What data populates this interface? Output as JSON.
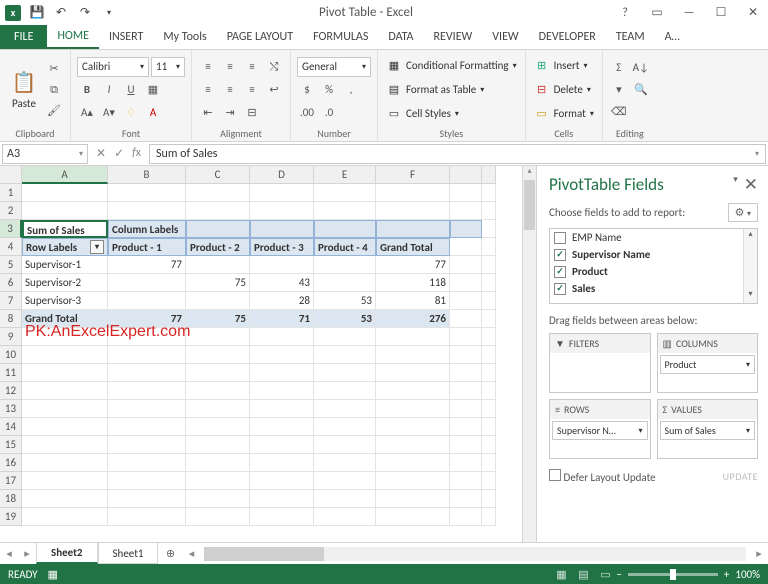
{
  "titlebar": {
    "title": "Pivot Table - Excel",
    "excel_icon_letter": "x"
  },
  "tabs": {
    "file": "FILE",
    "list": [
      "HOME",
      "INSERT",
      "My Tools",
      "PAGE LAYOUT",
      "FORMULAS",
      "DATA",
      "REVIEW",
      "VIEW",
      "DEVELOPER",
      "TEAM",
      "A…"
    ],
    "active": "HOME"
  },
  "ribbon": {
    "clipboard": {
      "label": "Clipboard",
      "paste": "Paste"
    },
    "font": {
      "label": "Font",
      "name": "Calibri",
      "size": "11"
    },
    "alignment": {
      "label": "Alignment"
    },
    "number": {
      "label": "Number",
      "format": "General"
    },
    "styles": {
      "label": "Styles",
      "cond": "Conditional Formatting",
      "table": "Format as Table",
      "cellstyles": "Cell Styles"
    },
    "cells": {
      "label": "Cells",
      "insert": "Insert",
      "delete": "Delete",
      "format": "Format"
    },
    "editing": {
      "label": "Editing"
    }
  },
  "namebox": "A3",
  "formula": "Sum of Sales",
  "columns": [
    "A",
    "B",
    "C",
    "D",
    "E",
    "F",
    "",
    ""
  ],
  "pivot": {
    "a3": "Sum of Sales",
    "b3": "Column Labels",
    "a4": "Row Labels",
    "col_headers": [
      "Product - 1",
      "Product - 2",
      "Product - 3",
      "Product - 4",
      "Grand Total"
    ],
    "rows": [
      {
        "label": "Supervisor-1",
        "vals": [
          "77",
          "",
          "",
          "",
          "77"
        ]
      },
      {
        "label": "Supervisor-2",
        "vals": [
          "",
          "75",
          "43",
          "",
          "118"
        ]
      },
      {
        "label": "Supervisor-3",
        "vals": [
          "",
          "",
          "28",
          "53",
          "81"
        ]
      }
    ],
    "grand": {
      "label": "Grand Total",
      "vals": [
        "77",
        "75",
        "71",
        "53",
        "276"
      ]
    }
  },
  "watermark": "PK:AnExcelExpert.com",
  "panel": {
    "title": "PivotTable Fields",
    "caption": "Choose fields to add to report:",
    "fields": [
      {
        "name": "EMP Name",
        "checked": false
      },
      {
        "name": "Supervisor Name",
        "checked": true
      },
      {
        "name": "Product",
        "checked": true
      },
      {
        "name": "Sales",
        "checked": true
      }
    ],
    "dragtxt": "Drag fields between areas below:",
    "filters": "FILTERS",
    "columns": "COLUMNS",
    "rowsArea": "ROWS",
    "values": "VALUES",
    "col_chip": "Product",
    "row_chip": "Supervisor N…",
    "val_chip": "Sum of Sales",
    "defer": "Defer Layout Update",
    "update": "UPDATE"
  },
  "sheets": {
    "active": "Sheet2",
    "other": "Sheet1"
  },
  "status": {
    "ready": "READY",
    "zoom": "100%"
  }
}
